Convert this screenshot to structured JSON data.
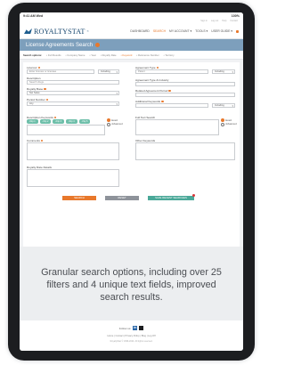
{
  "statusbar": {
    "time": "9:41 AM  Wed",
    "battery": "100%"
  },
  "util_links": [
    "Sign in",
    "Log out",
    "Help",
    "Contact"
  ],
  "logo": {
    "text": "ROYALTYSTAT",
    "reg": "®"
  },
  "nav": [
    {
      "label": "DASHBOARD",
      "active": false
    },
    {
      "label": "SEARCH",
      "active": true
    },
    {
      "label": "MY ACCOUNT ▾",
      "active": false
    },
    {
      "label": "TOOLS ▾",
      "active": false
    },
    {
      "label": "USER GUIDE ▾",
      "active": false
    }
  ],
  "page_title": "License Agreements Search",
  "subtabs": [
    {
      "label": "Search options:",
      "active": false
    },
    {
      "label": "• Full Results",
      "active": false
    },
    {
      "label": "• Company Name",
      "active": false
    },
    {
      "label": "• Year",
      "active": false
    },
    {
      "label": "• Royalty Rate",
      "active": false
    },
    {
      "label": "• Keyword",
      "active": true
    },
    {
      "label": "• Reference Number",
      "active": false
    },
    {
      "label": "• Territory",
      "active": false
    }
  ],
  "form": {
    "licensor": {
      "label": "Licensor",
      "placeholder": "Enter licensor or licensee",
      "mode": "Including"
    },
    "agreement_type": {
      "label": "Agreement Type",
      "value": "Patent",
      "mode": "Including"
    },
    "description": {
      "label": "Description",
      "placeholder": "Search drugs"
    },
    "agreement_type_exact": {
      "label": "Agreement Type & Industry"
    },
    "royalty_base": {
      "label": "Royalty Base",
      "value": "Net Sales"
    },
    "related_agreement": {
      "label": "Related Agreement Period"
    },
    "period": {
      "label": "Period Number",
      "value": "Any"
    },
    "additional": {
      "label": "Additional Keywords",
      "mode": "Including"
    },
    "description_keywords": {
      "label": "Description Keywords",
      "chips": [
        "chip 1",
        "chip 2",
        "chip 3",
        "chip 4",
        "chip 5"
      ]
    },
    "full_text": {
      "label": "Full Text Search"
    },
    "radio_options": [
      "Exact",
      "Advanced"
    ],
    "comments": {
      "label": "Comments"
    },
    "other_keywords": {
      "label": "Other Keywords"
    },
    "royalty_rate_details": {
      "label": "Royalty Rate Details"
    }
  },
  "buttons": {
    "search": "SEARCH",
    "reset": "RESET",
    "save": "SAVE RECENT SEARCHES"
  },
  "caption": "Granular search options, including over 25 filters and 4 unique text fields, improved search results.",
  "footer": {
    "follow": "Follow us:",
    "links": "Home  |  Contact  |  Privacy Policy  |  Blog  |  Log Off",
    "copyright": "RoyaltyStat © 1996-2024. All rights reserved."
  },
  "colors": {
    "accent": "#e8782b",
    "brand": "#16466e",
    "title_bar": "#7d9fbc",
    "chip": "#6fbfaa",
    "save_button": "#4aa898"
  }
}
